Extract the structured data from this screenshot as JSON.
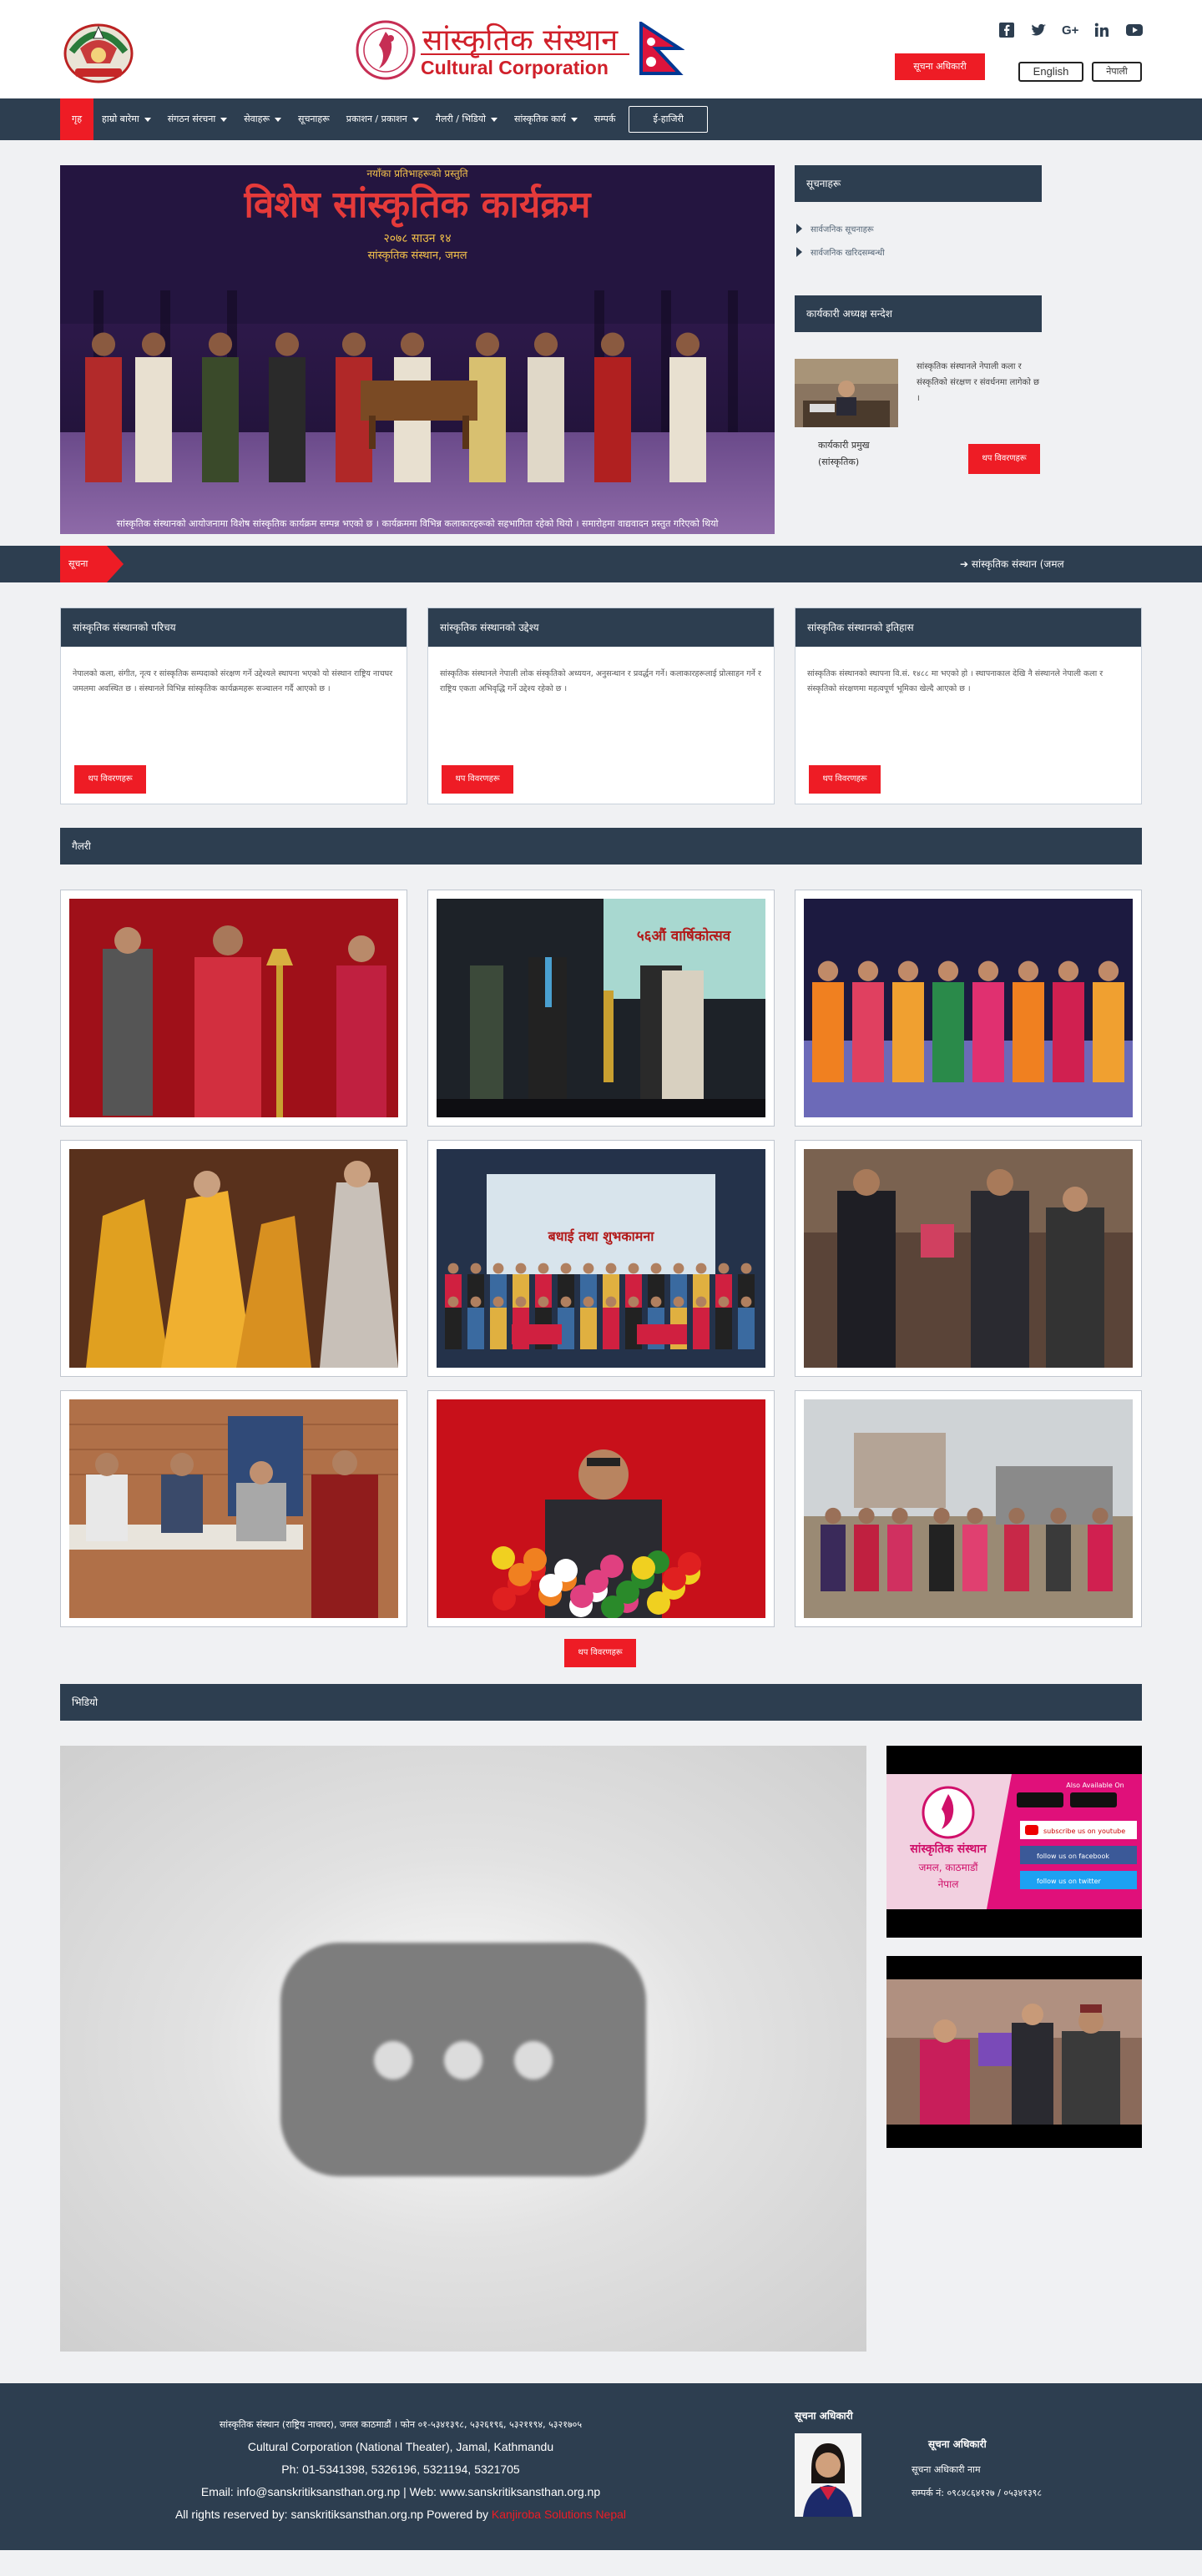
{
  "header": {
    "brand_ne": "सांस्कृतिक संस्थान",
    "brand_en": "Cultural Corporation",
    "top_button": "सूचना अधिकारी",
    "lang_en": "English",
    "lang_ne": "नेपाली",
    "social_icons": [
      "facebook-icon",
      "twitter-icon",
      "google-plus-icon",
      "linkedin-icon",
      "youtube-icon"
    ]
  },
  "nav": {
    "items": [
      {
        "label": "गृह",
        "dropdown": false
      },
      {
        "label": "हाम्रो बारेमा",
        "dropdown": true
      },
      {
        "label": "संगठन संरचना",
        "dropdown": true
      },
      {
        "label": "सेवाहरू",
        "dropdown": true
      },
      {
        "label": "सूचनाहरू",
        "dropdown": false
      },
      {
        "label": "प्रकाशन / प्रकाशन",
        "dropdown": true
      },
      {
        "label": "गैलरी / भिडियो",
        "dropdown": true
      },
      {
        "label": "सांस्कृतिक कार्य",
        "dropdown": true
      },
      {
        "label": "सम्पर्क",
        "dropdown": false
      }
    ],
    "outline_button": "ई-हाजिरी"
  },
  "hero": {
    "banner_title": "विशेष सांस्कृतिक कार्यक्रम",
    "banner_top": "नयाँका प्रतिभाहरूको प्रस्तुति",
    "banner_sub": "२०७८ साउन १४",
    "banner_sub2": "सांस्कृतिक संस्थान, जमल",
    "caption": "सांस्कृतिक संस्थानको आयोजनामा विशेष सांस्कृतिक कार्यक्रम सम्पन्न भएको छ । कार्यक्रममा विभिन्न कलाकारहरूको सहभागिता रहेको थियो । समारोहमा वाद्यवादन प्रस्तुत गरिएको थियो"
  },
  "sidebar": {
    "notices_title": "सूचनाहरू",
    "links": [
      "सार्वजनिक सूचनाहरू",
      "सार्वजनिक खरिदसम्बन्धी"
    ],
    "chief_title": "कार्यकारी अध्यक्ष सन्देश",
    "chief_text": "सांस्कृतिक संस्थानले नेपाली कला र संस्कृतिको संरक्षण र संवर्धनमा लागेको छ ।",
    "chief_name": "कार्यकारी प्रमुख",
    "chief_role": "(सांस्कृतिक)",
    "more": "थप विवरणहरू"
  },
  "ticker": {
    "label": "सूचना",
    "text": "➔ सांस्कृतिक संस्थान (जमल"
  },
  "cards": [
    {
      "title": "सांस्कृतिक संस्थानको परिचय",
      "body": "नेपालको कला, संगीत, नृत्य र सांस्कृतिक सम्पदाको संरक्षण गर्ने उद्देश्यले स्थापना भएको यो संस्थान राष्ट्रिय नाचघर जमलमा अवस्थित छ । संस्थानले विभिन्न सांस्कृतिक कार्यक्रमहरू सञ्चालन गर्दै आएको छ ।",
      "more": "थप विवरणहरू"
    },
    {
      "title": "सांस्कृतिक संस्थानको उद्देश्य",
      "body": "सांस्कृतिक संस्थानले नेपाली लोक संस्कृतिको अध्ययन, अनुसन्धान र प्रवर्द्धन गर्ने। कलाकारहरूलाई प्रोत्साहन गर्ने र राष्ट्रिय एकता अभिवृद्धि गर्ने उद्देश्य रहेको छ ।",
      "more": "थप विवरणहरू"
    },
    {
      "title": "सांस्कृतिक संस्थानको इतिहास",
      "body": "सांस्कृतिक संस्थानको स्थापना वि.सं. १४८८ मा भएको हो । स्थापनाकाल देखि नै संस्थानले नेपाली कला र संस्कृतिको संरक्षणमा महत्वपूर्ण भूमिका खेल्दै आएको छ ।",
      "more": "थप विवरणहरू"
    }
  ],
  "gallery": {
    "title": "गैलरी",
    "more": "थप विवरणहरू",
    "photo2_banner": "५६औं वार्षिकोत्सव",
    "photo5_banner": "बधाई तथा शुभकामना"
  },
  "video": {
    "title": "भिडियो",
    "promo_title": "सांस्कृतिक संस्थान",
    "promo_sub": "जमल, काठमाडौं",
    "promo_country": "नेपाल",
    "promo_links": [
      "subscribe us on youtube",
      "follow us on facebook",
      "follow us on twitter"
    ],
    "promo_top": "Also Available On"
  },
  "footer": {
    "line1": "सांस्कृतिक संस्थान (राष्ट्रिय नाचघर), जमल काठमाडौं । फोन ०१-५३४१३९८, ५३२६१९६, ५३२११९४, ५३२१७०५",
    "line2": "Cultural Corporation (National Theater), Jamal, Kathmandu",
    "line3": "Ph: 01-5341398, 5326196, 5321194, 5321705",
    "line4": "Email: info@sanskritiksansthan.org.np | Web: www.sanskritiksansthan.org.np",
    "line5_prefix": "All rights reserved by: sanskritiksansthan.org.np Powered by ",
    "line5_link": "Kanjiroba Solutions Nepal",
    "info_title": "सूचना अधिकारी",
    "info_name": "सूचना अधिकारी",
    "info_role": "सूचना अधिकारी नाम",
    "info_phone": "सम्पर्क नं: ०९८४८६४१२७ / ०५३४१३९८"
  },
  "colors": {
    "navy": "#2d3e50",
    "red": "#ee1c25",
    "background": "#f0f1f3"
  }
}
